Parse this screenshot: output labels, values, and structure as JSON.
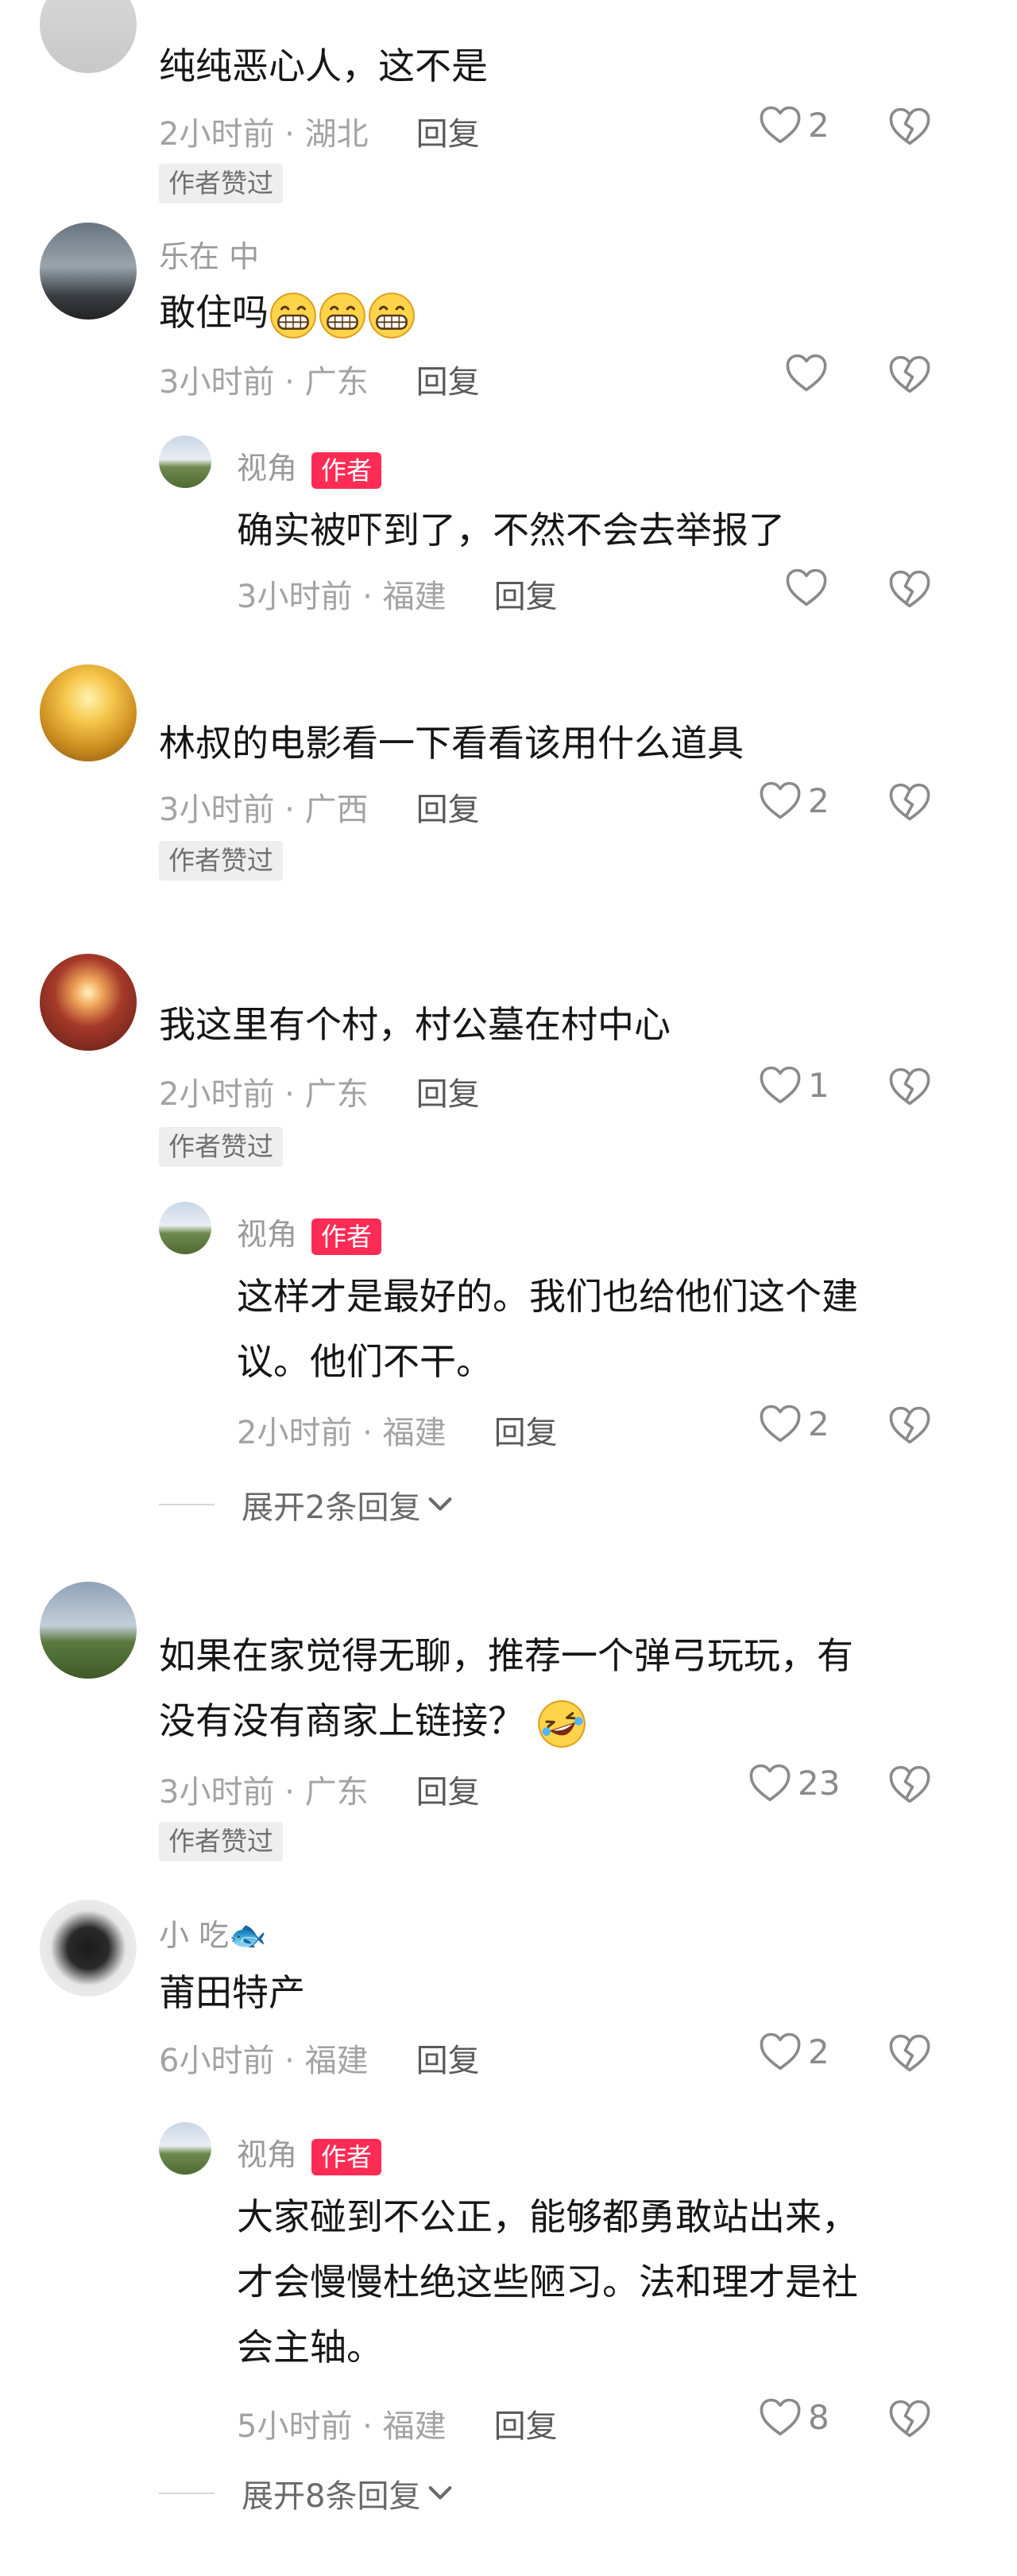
{
  "colors": {
    "accent": "#fe2c55",
    "muted": "#a3a3a3",
    "text": "#161616"
  },
  "icons": {
    "like": "heart-outline-icon",
    "dislike": "broken-heart-icon",
    "expand": "chevron-down-icon"
  },
  "comments": [
    {
      "text": "纯纯恶心人，这不是",
      "time": "2小时前 · 湖北",
      "reply": "回复",
      "likes": "2",
      "liked_badge": "作者赞过"
    },
    {
      "user": "乐在    中",
      "text": "敢住吗",
      "time": "3小时前 · 广东",
      "reply": "回复",
      "likes": ""
    },
    {
      "user": "视角",
      "author_tag": "作者",
      "text": "确实被吓到了，不然不会去举报了",
      "time": "3小时前 · 福建",
      "reply": "回复",
      "likes": ""
    },
    {
      "text": "林叔的电影看一下看看该用什么道具",
      "time": "3小时前 · 广西",
      "reply": "回复",
      "likes": "2",
      "liked_badge": "作者赞过"
    },
    {
      "text": "我这里有个村，村公墓在村中心",
      "time": "2小时前 · 广东",
      "reply": "回复",
      "likes": "1",
      "liked_badge": "作者赞过"
    },
    {
      "user": "视角",
      "author_tag": "作者",
      "text1": "这样才是最好的。我们也给他们这个建",
      "text2": "议。他们不干。",
      "time": "2小时前 · 福建",
      "reply": "回复",
      "likes": "2",
      "expand": "展开2条回复"
    },
    {
      "text1": "如果在家觉得无聊，推荐一个弹弓玩玩，有",
      "text2": "没有没有商家上链接？",
      "time": "3小时前 · 广东",
      "reply": "回复",
      "likes": "23",
      "liked_badge": "作者赞过"
    },
    {
      "user": "小    吃",
      "text": "莆田特产",
      "time": "6小时前 · 福建",
      "reply": "回复",
      "likes": "2"
    },
    {
      "user": "视角",
      "author_tag": "作者",
      "text1": "大家碰到不公正，能够都勇敢站出来，",
      "text2": "才会慢慢杜绝这些陋习。法和理才是社",
      "text3": "会主轴。",
      "time": "5小时前 · 福建",
      "reply": "回复",
      "likes": "8",
      "expand": "展开8条回复"
    }
  ]
}
